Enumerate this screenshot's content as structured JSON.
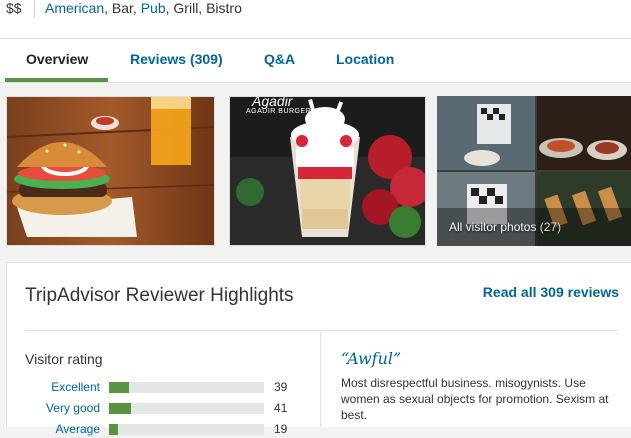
{
  "info": {
    "price": "$$",
    "cuisines": [
      {
        "text": "American",
        "link": true
      },
      {
        "text": ", Bar, ",
        "link": false
      },
      {
        "text": "Pub",
        "link": true
      },
      {
        "text": ", Grill, Bistro",
        "link": false
      }
    ]
  },
  "tabs": {
    "overview": "Overview",
    "reviews": "Reviews",
    "reviews_count": "(309)",
    "qa": "Q&A",
    "location": "Location"
  },
  "photos": {
    "p2_logo": "AGADIR BURGER",
    "visitor_caption": "All visitor photos",
    "visitor_count": "(27)"
  },
  "highlights": {
    "title": "TripAdvisor Reviewer Highlights",
    "read_all": "Read all 309 reviews",
    "visitor_rating_title": "Visitor rating",
    "ratings": [
      {
        "label": "Excellent",
        "count": "39",
        "fraction": 0.13
      },
      {
        "label": "Very good",
        "count": "41",
        "fraction": 0.14
      },
      {
        "label": "Average",
        "count": "19",
        "fraction": 0.06
      }
    ],
    "review_quote": "“Awful”",
    "review_text": "Most disrespectful business. misogynists. Use women as sexual objects for promotion. Sexism at best."
  },
  "colors": {
    "link": "#006699",
    "green": "#589442"
  }
}
